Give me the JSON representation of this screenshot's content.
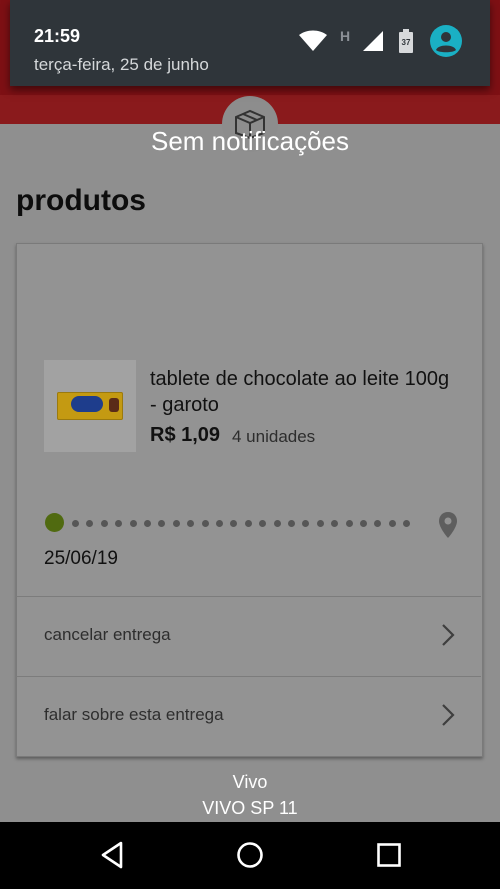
{
  "status": {
    "time": "21:59",
    "date": "terça-feira, 25 de junho",
    "network_type": "H",
    "battery_level": "37",
    "icons": [
      "wifi-icon",
      "signal-icon",
      "battery-icon",
      "account-icon"
    ]
  },
  "notifications": {
    "empty_text": "Sem notificações"
  },
  "page": {
    "title": "produtos"
  },
  "product": {
    "name": "tablete de chocolate ao leite 100g - garoto",
    "price": "R$ 1,09",
    "quantity": "4 unidades"
  },
  "delivery": {
    "date": "25/06/19",
    "progress": 0
  },
  "actions": [
    {
      "label": "cancelar entrega"
    },
    {
      "label": "falar sobre esta entrega"
    }
  ],
  "carrier": {
    "line1": "Vivo",
    "line2": "VIVO SP 11"
  },
  "colors": {
    "brand_red": "#7e1014",
    "progress_green": "#506a10",
    "account_icon": "#1ab0c4"
  }
}
